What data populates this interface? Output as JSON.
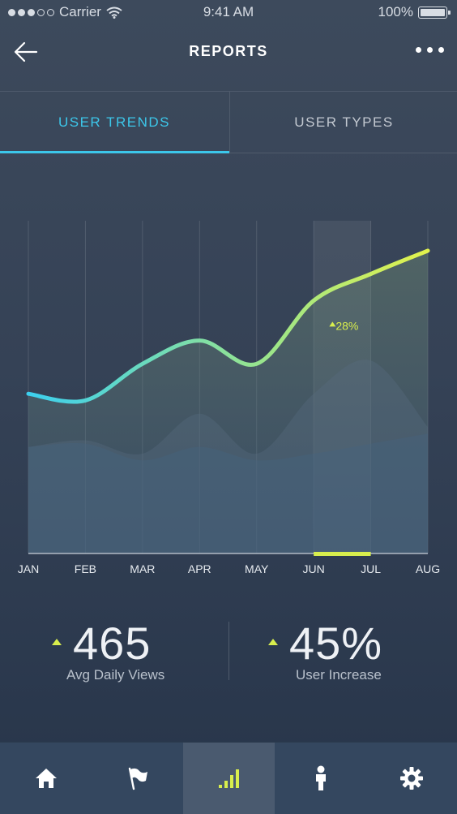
{
  "status_bar": {
    "carrier": "Carrier",
    "time": "9:41 AM",
    "battery": "100%"
  },
  "header": {
    "title": "REPORTS",
    "back_icon": "arrow-left-icon",
    "more_icon": "more-dots-icon"
  },
  "tabs": [
    {
      "label": "USER TRENDS",
      "active": true
    },
    {
      "label": "USER TYPES",
      "active": false
    }
  ],
  "chart_data": {
    "type": "area",
    "categories": [
      "JAN",
      "FEB",
      "MAR",
      "APR",
      "MAY",
      "JUN",
      "JUL",
      "AUG"
    ],
    "series": [
      {
        "values": [
          48,
          46,
          57,
          64,
          57,
          76,
          84,
          91
        ]
      },
      {
        "values": [
          32,
          34,
          30,
          42,
          30,
          48,
          58,
          38
        ]
      },
      {
        "values": [
          32,
          33,
          28,
          32,
          28,
          30,
          33,
          36
        ]
      }
    ],
    "ylim": [
      0,
      100
    ],
    "highlight_range": [
      "JUN",
      "JUL"
    ],
    "annotation": "28%",
    "line_colors": [
      "#3ccfee",
      "#9be58a",
      "#e3f24c"
    ]
  },
  "stats": [
    {
      "value": "465",
      "label": "Avg Daily Views"
    },
    {
      "value": "45%",
      "label": "User Increase"
    }
  ],
  "tab_bar": {
    "items": [
      {
        "icon": "home-icon",
        "active": false
      },
      {
        "icon": "flag-icon",
        "active": false
      },
      {
        "icon": "signal-bars-icon",
        "active": true
      },
      {
        "icon": "person-icon",
        "active": false
      },
      {
        "icon": "gear-icon",
        "active": false
      }
    ]
  },
  "colors": {
    "accent": "#3cc7ea",
    "highlight": "#d8ee4d"
  }
}
